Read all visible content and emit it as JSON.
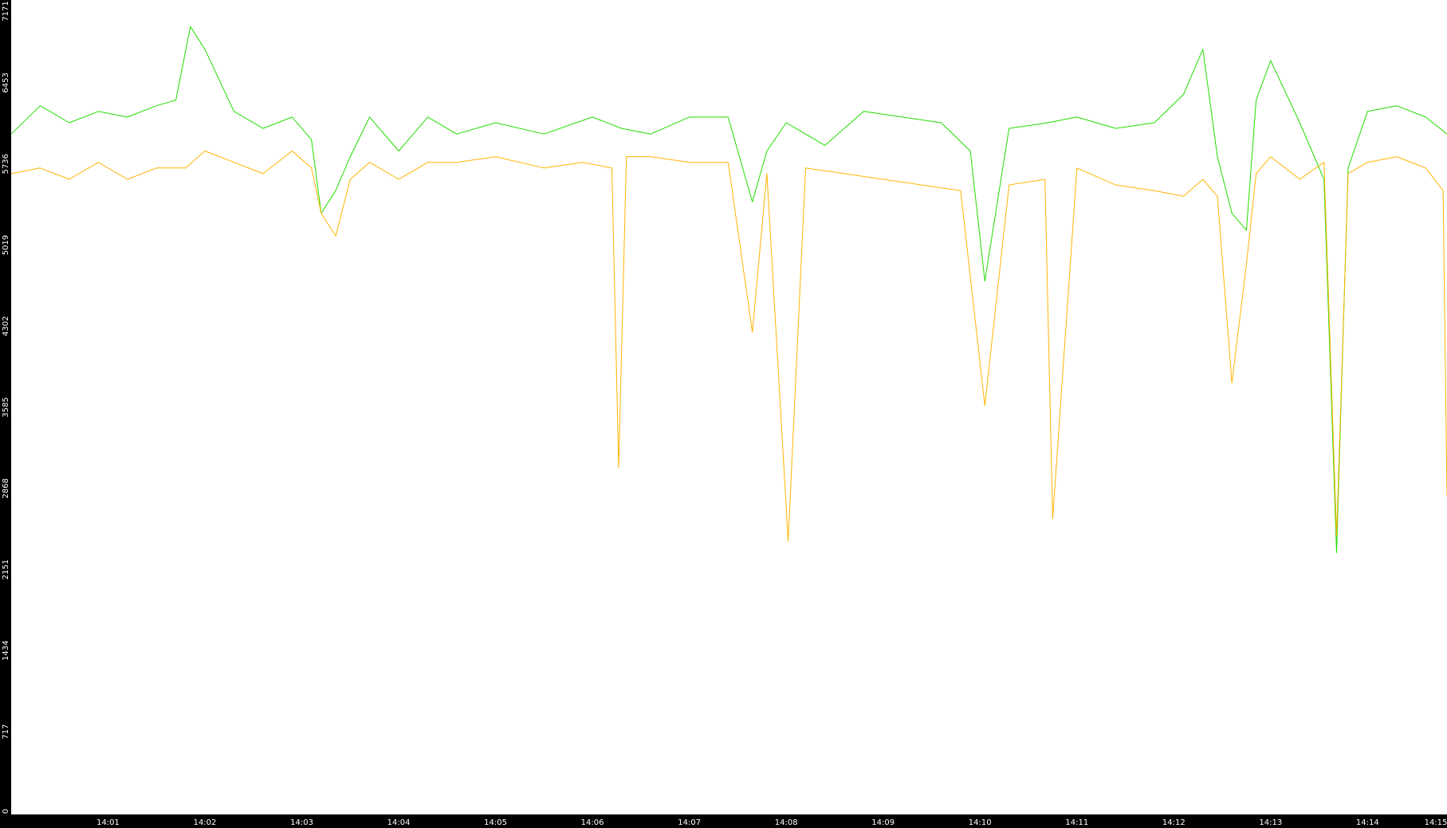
{
  "colors": {
    "background": "#ffffff",
    "axis": "#000000",
    "axis_text": "#ffffff",
    "series_green": "#22dd00",
    "series_orange": "#ffb400"
  },
  "chart_data": {
    "type": "line",
    "title": "",
    "xlabel": "",
    "ylabel": "",
    "ylim": [
      0,
      7171
    ],
    "y_ticks": [
      "0",
      "717",
      "1434",
      "2151",
      "2868",
      "3585",
      "4302",
      "5019",
      "5736",
      "6453",
      "7171"
    ],
    "x_range_minutes": [
      0.0,
      14.82
    ],
    "x_ticks": [
      "14:01",
      "14:02",
      "14:03",
      "14:04",
      "14:05",
      "14:06",
      "14:07",
      "14:08",
      "14:09",
      "14:10",
      "14:11",
      "14:12",
      "14:13",
      "14:14",
      "14:15"
    ],
    "grid": false,
    "legend": "none",
    "series": [
      {
        "color": "#22dd00",
        "x": [
          0.0,
          0.3,
          0.6,
          0.9,
          1.2,
          1.5,
          1.7,
          1.85,
          2.0,
          2.3,
          2.6,
          2.9,
          3.1,
          3.2,
          3.35,
          3.5,
          3.7,
          4.0,
          4.3,
          4.6,
          5.0,
          5.5,
          6.0,
          6.3,
          6.6,
          7.0,
          7.4,
          7.65,
          7.8,
          8.0,
          8.4,
          8.8,
          9.2,
          9.6,
          9.9,
          10.05,
          10.3,
          10.7,
          11.0,
          11.4,
          11.8,
          12.1,
          12.3,
          12.45,
          12.6,
          12.75,
          12.85,
          13.0,
          13.3,
          13.55,
          13.68,
          13.8,
          14.0,
          14.3,
          14.6,
          14.82
        ],
        "y": [
          6000,
          6250,
          6100,
          6200,
          6150,
          6250,
          6300,
          6950,
          6750,
          6200,
          6050,
          6150,
          5950,
          5300,
          5500,
          5800,
          6150,
          5850,
          6150,
          6000,
          6100,
          6000,
          6150,
          6050,
          6000,
          6150,
          6150,
          5400,
          5850,
          6100,
          5900,
          6200,
          6150,
          6100,
          5850,
          4700,
          6050,
          6100,
          6150,
          6050,
          6100,
          6350,
          6750,
          5800,
          5300,
          5150,
          6300,
          6650,
          6100,
          5600,
          2300,
          5700,
          6200,
          6250,
          6150,
          6000
        ]
      },
      {
        "color": "#ffb400",
        "x": [
          0.0,
          0.3,
          0.6,
          0.9,
          1.2,
          1.5,
          1.8,
          2.0,
          2.3,
          2.6,
          2.9,
          3.1,
          3.2,
          3.35,
          3.5,
          3.7,
          4.0,
          4.3,
          4.6,
          5.0,
          5.5,
          5.9,
          6.2,
          6.27,
          6.35,
          6.6,
          7.0,
          7.4,
          7.65,
          7.8,
          8.02,
          8.2,
          8.6,
          9.0,
          9.4,
          9.8,
          10.05,
          10.3,
          10.67,
          10.75,
          11.0,
          11.4,
          11.8,
          12.1,
          12.3,
          12.45,
          12.6,
          12.75,
          12.85,
          13.0,
          13.3,
          13.55,
          13.68,
          13.8,
          14.0,
          14.3,
          14.6,
          14.78,
          14.82
        ],
        "y": [
          5650,
          5700,
          5600,
          5750,
          5600,
          5700,
          5700,
          5850,
          5750,
          5650,
          5850,
          5700,
          5300,
          5100,
          5600,
          5750,
          5600,
          5750,
          5750,
          5800,
          5700,
          5750,
          5700,
          3050,
          5800,
          5800,
          5750,
          5750,
          4250,
          5650,
          2400,
          5700,
          5650,
          5600,
          5550,
          5500,
          3600,
          5550,
          5600,
          2600,
          5700,
          5550,
          5500,
          5450,
          5600,
          5450,
          3800,
          4850,
          5650,
          5800,
          5600,
          5750,
          2450,
          5650,
          5750,
          5800,
          5700,
          5500,
          2800
        ]
      }
    ]
  }
}
